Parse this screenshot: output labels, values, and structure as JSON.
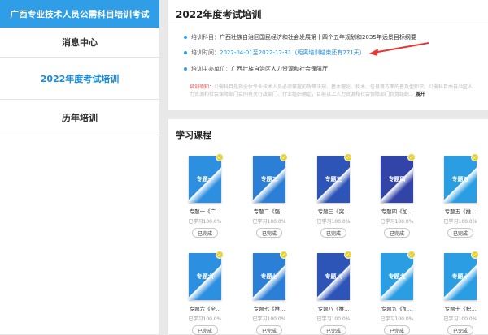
{
  "sidebar": {
    "banner": "广西专业技术人员公需科目培训考试",
    "items": [
      {
        "label": "消息中心"
      },
      {
        "label": "2022年度考试培训"
      },
      {
        "label": "历年培训"
      }
    ]
  },
  "info": {
    "title": "2022年度考试培训",
    "subject_label": "培训科目：",
    "subject_value": "广西壮族自治区国民经济和社会发展第十四个五年规划和2035年远景目标纲要",
    "time_label": "培训时间：",
    "time_value": "2022-04-01至2022-12-31（距离培训结束还有271天）",
    "org_label": "培训主办单位：",
    "org_value": "广西壮族自治区人力资源和社会保障厅",
    "notice_label": "培训须知：",
    "notice_text": "公需科目是指全体专业技术人员必须掌握的政策法规、基本理论、技术、信息等方面的普及型知识。公需科目由自治区人力资源和社会保障部门会同有关行政部门、行业组织确定，目前以上人力资源和社会保障部门负责组织...",
    "expand": "展开",
    "accent": "#1a8ce0",
    "arrow_color": "#e53935"
  },
  "courses": {
    "title": "学习课程",
    "items": [
      {
        "thumb": "专题一",
        "name": "专题一《广...",
        "progress": "已学习100.0%",
        "status": "已完成",
        "color": "#2c8fe0"
      },
      {
        "thumb": "专题二",
        "name": "专题二《强...",
        "progress": "已学习100.0%",
        "status": "已完成",
        "color": "#2b7fd6"
      },
      {
        "thumb": "专题三",
        "name": "专题三《突...",
        "progress": "已学习100.0%",
        "status": "已完成",
        "color": "#2d55b8"
      },
      {
        "thumb": "专题四",
        "name": "专题四《加...",
        "progress": "已学习100.0%",
        "status": "已完成",
        "color": "#3344a8"
      },
      {
        "thumb": "专题五",
        "name": "专题五《推...",
        "progress": "已学习100.0%",
        "status": "已完成",
        "color": "#2a9de3"
      },
      {
        "thumb": "专题六",
        "name": "专题六《全...",
        "progress": "已学习100.0%",
        "status": "已完成",
        "color": "#2c8fe0"
      },
      {
        "thumb": "专题七",
        "name": "专题七《推...",
        "progress": "已学习100.0%",
        "status": "已完成",
        "color": "#2b7fd6"
      },
      {
        "thumb": "专题八",
        "name": "专题八《推...",
        "progress": "已学习100.0%",
        "status": "已完成",
        "color": "#2d55b8"
      },
      {
        "thumb": "专题九",
        "name": "专题九《加...",
        "progress": "已学习100.0%",
        "status": "已完成",
        "color": "#2a9de3"
      },
      {
        "thumb": "专题十",
        "name": "专题十《积...",
        "progress": "已学习100.0%",
        "status": "已完成",
        "color": "#2a9de3"
      }
    ]
  }
}
